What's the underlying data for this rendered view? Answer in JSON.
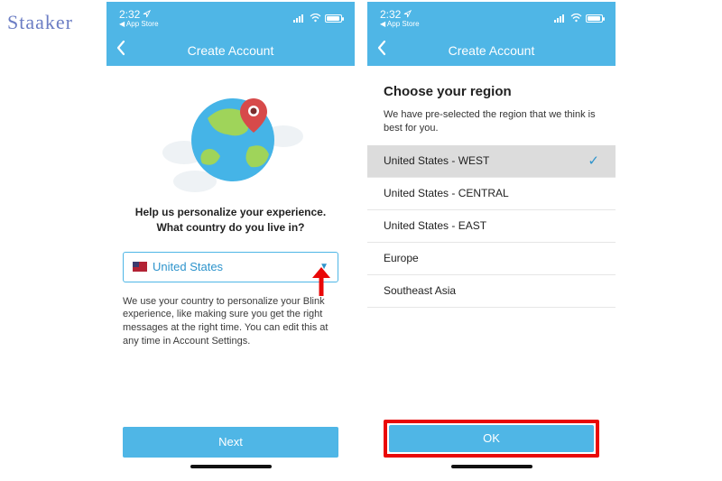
{
  "watermark": "Staaker",
  "status": {
    "time": "2:32",
    "appstore": "◀ App Store"
  },
  "nav": {
    "title": "Create Account"
  },
  "screen1": {
    "heading_line1": "Help us personalize your experience.",
    "heading_line2": "What country do you live in?",
    "country": "United States",
    "disclaimer": "We use your country to personalize your Blink experience, like making sure you get the right messages at the right time. You can edit this at any time in Account Settings.",
    "next": "Next"
  },
  "screen2": {
    "title": "Choose your region",
    "sub": "We have pre-selected the region that we think is best for you.",
    "regions": {
      "r0": "United States - WEST",
      "r1": "United States - CENTRAL",
      "r2": "United States - EAST",
      "r3": "Europe",
      "r4": "Southeast Asia"
    },
    "ok": "OK"
  }
}
